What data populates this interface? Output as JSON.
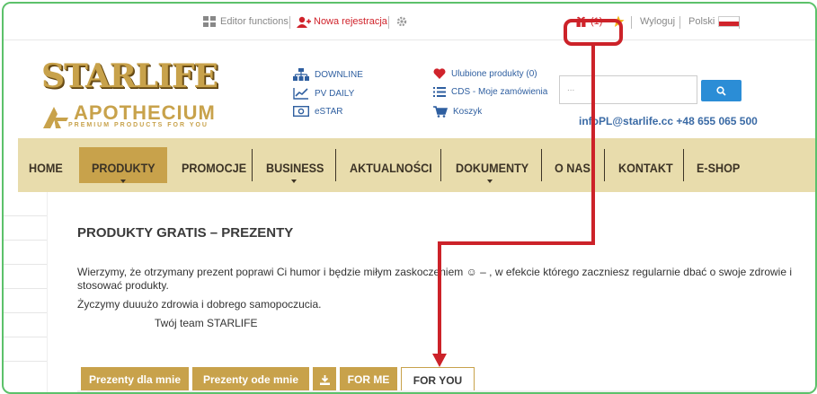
{
  "topbar": {
    "editor_functions": "Editor functions",
    "nowa_rejestracja": "Nowa rejestracja",
    "gift_count": "(1)",
    "wyloguj": "Wyloguj",
    "language": "Polski"
  },
  "logos": {
    "starlife": "STARLIFE",
    "apothecium": "APOTHECIUM",
    "apothecium_sub": "PREMIUM PRODUCTS FOR YOU"
  },
  "header_links": {
    "downline": "DOWNLINE",
    "pv_daily": "PV DAILY",
    "estar": "eSTAR",
    "ulubione": "Ulubione produkty (0)",
    "cds": "CDS - Moje zamówienia",
    "koszyk": "Koszyk"
  },
  "search": {
    "placeholder": "..."
  },
  "contact": "infoPL@starlife.cc +48 655 065 500",
  "nav": {
    "home": "HOME",
    "produkty": "PRODUKTY",
    "promocje": "PROMOCJE",
    "business": "BUSINESS",
    "aktualnosci": "AKTUALNOŚCI",
    "dokumenty": "DOKUMENTY",
    "o_nas": "O NAS",
    "kontakt": "KONTAKT",
    "eshop": "E-SHOP"
  },
  "content": {
    "title": "PRODUKTY GRATIS – PREZENTY",
    "para1": "Wierzymy, że otrzymany prezent poprawi Ci humor i będzie miłym zaskoczeniem ☺ – , w efekcie którego zaczniesz regularnie dbać o swoje zdrowie i",
    "para1b": "stosować produkty.",
    "para2": "Życzymy duuużo zdrowia i dobrego samopoczucia.",
    "signature": "Twój team STARLIFE"
  },
  "tabs": {
    "dla_mnie": "Prezenty dla mnie",
    "ode_mnie": "Prezenty ode mnie",
    "for_me": "FOR ME",
    "for_you": "FOR YOU"
  },
  "colors": {
    "gold": "#c8a24b",
    "nav_bg": "#e8dcac",
    "annotation": "#cc2229",
    "frame": "#5cc16a",
    "search_btn": "#2b8dd6"
  }
}
